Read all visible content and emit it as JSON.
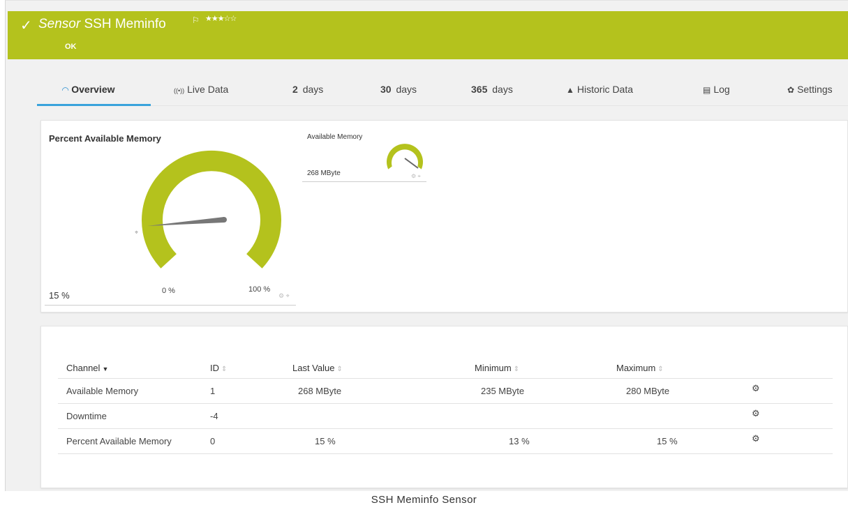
{
  "header": {
    "title_prefix": "Sensor",
    "title_name": "SSH Meminfo",
    "status": "OK",
    "check_icon": "✓",
    "flag_icon": "⚐",
    "stars": "★★★☆☆",
    "accent": "#b4c21d"
  },
  "tabs": [
    {
      "icon": "◠",
      "bold": "",
      "label": "Overview",
      "icon_name": "gauge-icon"
    },
    {
      "icon": "((•))",
      "bold": "",
      "label": "Live Data",
      "icon_name": "broadcast-icon"
    },
    {
      "icon": "",
      "bold": "2",
      "label": "days",
      "icon_name": ""
    },
    {
      "icon": "",
      "bold": "30",
      "label": "days",
      "icon_name": ""
    },
    {
      "icon": "",
      "bold": "365",
      "label": "days",
      "icon_name": ""
    },
    {
      "icon": "▲",
      "bold": "",
      "label": "Historic Data",
      "icon_name": "area-chart-icon"
    },
    {
      "icon": "▤",
      "bold": "",
      "label": "Log",
      "icon_name": "list-icon"
    },
    {
      "icon": "✿",
      "bold": "",
      "label": "Settings",
      "icon_name": "gear-icon"
    }
  ],
  "gauges": {
    "main": {
      "title": "Percent Available Memory",
      "value": "15 %",
      "value_fraction": 0.15,
      "min_label": "0 %",
      "max_label": "100 %"
    },
    "small": {
      "title": "Available Memory",
      "value": "268 MByte"
    }
  },
  "table": {
    "headers": {
      "channel": "Channel",
      "id": "ID",
      "last_value": "Last Value",
      "minimum": "Minimum",
      "maximum": "Maximum"
    },
    "rows": [
      {
        "channel": "Available Memory",
        "id": "1",
        "last_value": "268 MByte",
        "minimum": "235 MByte",
        "maximum": "280 MByte"
      },
      {
        "channel": "Downtime",
        "id": "-4",
        "last_value": "",
        "minimum": "",
        "maximum": ""
      },
      {
        "channel": "Percent Available Memory",
        "id": "0",
        "last_value": "15 %",
        "minimum": "13 %",
        "maximum": "15 %"
      }
    ]
  },
  "caption": "SSH Meminfo Sensor"
}
